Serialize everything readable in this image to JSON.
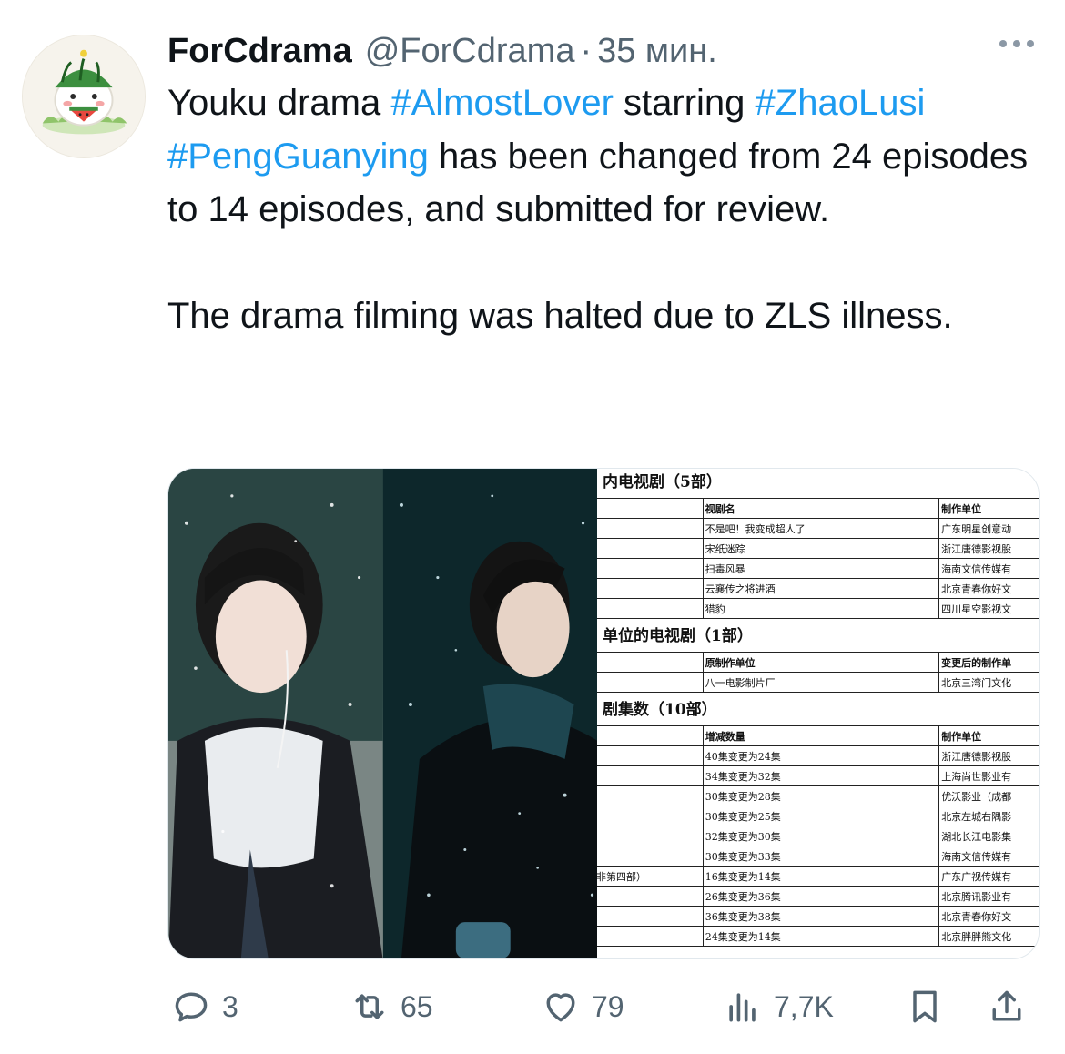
{
  "author": {
    "display_name": "ForCdrama",
    "handle": "@ForCdrama",
    "separator": "·",
    "time": "35 мин."
  },
  "tweet": {
    "line1_pre": "Youku drama ",
    "tag_almost": "#AlmostLover",
    "line1_mid": " starring ",
    "tag_zhao": "#ZhaoLusi",
    "tag_peng": "#PengGuanying",
    "line2_rest": " has been changed from 24 episodes to 14 episodes, and submitted for review.",
    "para2": "The drama filming was halted due to ZLS illness."
  },
  "media": {
    "doc": {
      "section1": "内电视剧（5部）",
      "s1_head": [
        "视剧名",
        "制作单位"
      ],
      "s1_rows": [
        [
          "不是吧！我变成超人了",
          "广东明星创意动"
        ],
        [
          "宋纸迷踪",
          "浙江唐德影视股"
        ],
        [
          "扫毒风暴",
          "海南文信传媒有"
        ],
        [
          "云襄传之将进酒",
          "北京青春你好文"
        ],
        [
          "猎豹",
          "四川星空影视文"
        ]
      ],
      "section2": "单位的电视剧（1部）",
      "s2_head": [
        "原制作单位",
        "变更后的制作单"
      ],
      "s2_rows": [
        [
          "八一电影制片厂",
          "北京三湾门文化"
        ]
      ],
      "section3": "剧集数（10部）",
      "s3_head": [
        "增减数量",
        "制作单位"
      ],
      "s3_rows": [
        [
          "",
          "40集变更为24集",
          "浙江唐德影视股"
        ],
        [
          "",
          "34集变更为32集",
          "上海尚世影业有"
        ],
        [
          "",
          "30集变更为28集",
          "优沃影业（成都"
        ],
        [
          "",
          "30集变更为25集",
          "北京左城右隅影"
        ],
        [
          "",
          "32集变更为30集",
          "湖北长江电影集"
        ],
        [
          "",
          "30集变更为33集",
          "海南文信传媒有"
        ],
        [
          "非第四部）",
          "16集变更为14集",
          "广东广视传媒有"
        ],
        [
          "",
          "26集变更为36集",
          "北京腾讯影业有"
        ],
        [
          "",
          "36集变更为38集",
          "北京青春你好文"
        ],
        [
          "",
          "24集变更为14集",
          "北京胖胖熊文化"
        ]
      ]
    }
  },
  "stats": {
    "replies": "3",
    "retweets": "65",
    "likes": "79",
    "views": "7,7K"
  },
  "colors": {
    "hashtag": "#1d9bf0",
    "secondary_text": "#536471",
    "primary_text": "#0f1419"
  },
  "icons": {
    "reply": "reply-icon",
    "retweet": "retweet-icon",
    "like": "heart-icon",
    "views": "views-chart-icon",
    "bookmark": "bookmark-icon",
    "share": "share-icon",
    "more": "more-dots-icon"
  }
}
